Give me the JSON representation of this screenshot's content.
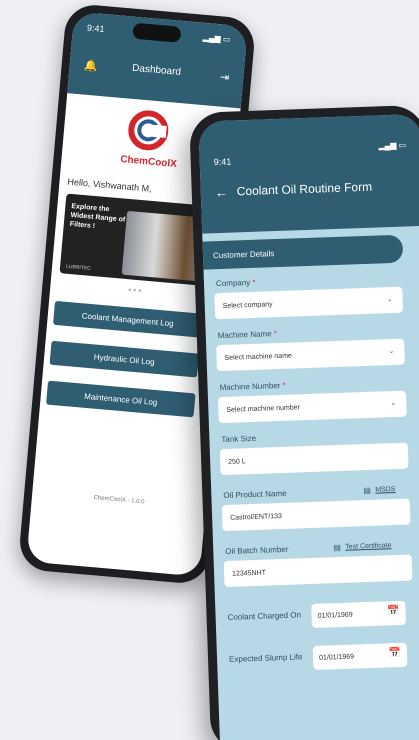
{
  "back_phone": {
    "status_time": "9:41",
    "header_title": "Dashboard",
    "brand_name": "ChemCoolX",
    "greeting": "Hello, Vishwanath M,",
    "banner_text": "Explore the Widest Range of Filters !",
    "banner_brand": "LUBRITEC",
    "pager_dots": "• • •",
    "buttons": [
      "Coolant Management Log",
      "Hydraulic Oil Log",
      "Maintenance Oil Log"
    ],
    "footer": "ChemCoolX - 1.0.0"
  },
  "front_phone": {
    "status_time": "9:41",
    "header_title": "Coolant Oil Routine Form",
    "section_title": "Customer Details",
    "fields": [
      {
        "label": "Company",
        "required": "*",
        "value": "Select company"
      },
      {
        "label": "Machine Name",
        "required": "*",
        "value": "Select machine name"
      },
      {
        "label": "Machine Number",
        "required": "*",
        "value": "Select machine number"
      },
      {
        "label": "Tank Size",
        "required": "",
        "value": "250 L"
      },
      {
        "label": "Oil Product Name",
        "required": "",
        "value": "Castrol/ENT/133"
      },
      {
        "label": "Oil Batch Number",
        "required": "",
        "value": "12345NHT"
      }
    ],
    "msds_link": "MSDS",
    "test_certificate_link": "Test Certificate",
    "coolant_charged_label": "Coolant Charged On",
    "coolant_charged_value": "01/01/1969",
    "expected_sump_label": "Expected Slump Life",
    "expected_sump_value": "01/01/1969"
  }
}
